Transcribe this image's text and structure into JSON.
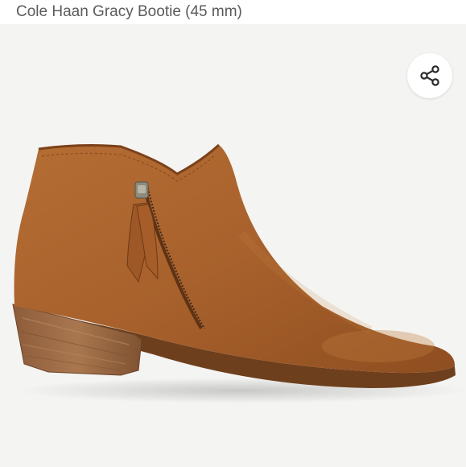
{
  "product": {
    "title": "Cole Haan Gracy Bootie (45 mm)"
  },
  "image": {
    "subject": "boot-photo"
  },
  "share": {
    "icon": "share-icon"
  },
  "colors": {
    "suede": "#a8612c",
    "heel_wood": "#9c6b45",
    "background": "#f4f4f2",
    "title_text": "#5b5b5b"
  }
}
